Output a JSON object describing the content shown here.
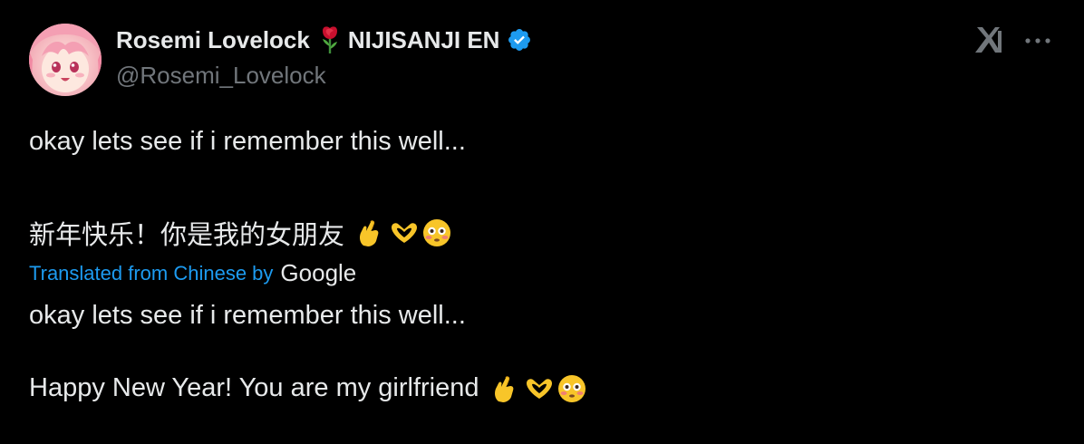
{
  "author": {
    "display_name": "Rosemi Lovelock",
    "affiliation": "NIJISANJI EN",
    "handle": "@Rosemi_Lovelock",
    "rose_icon": "rose-icon",
    "verified_icon": "verified-badge-icon",
    "verified_color": "#1d9bf0"
  },
  "header": {
    "x_logo": "x-grok-icon",
    "more_icon": "more-options-icon"
  },
  "tweet": {
    "original_line1": "okay lets see if i remember this well...",
    "original_line2": "新年快乐！你是我的女朋友",
    "translation_label": "Translated from Chinese by",
    "translation_provider": "Google",
    "translated_line1": "okay lets see if i remember this well...",
    "translated_line2": "Happy New Year! You are my girlfriend",
    "emojis": [
      "finger-heart-emoji",
      "heart-hands-emoji",
      "flushed-face-emoji"
    ]
  },
  "colors": {
    "background": "#000000",
    "text": "#e7e9ea",
    "secondary": "#71767b",
    "link": "#1d9bf0"
  }
}
